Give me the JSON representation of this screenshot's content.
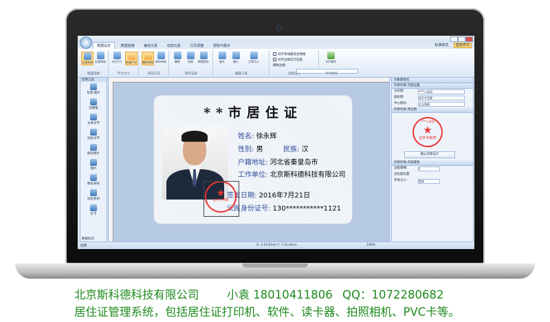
{
  "app": {
    "ribbon_tabs": [
      "数据设定",
      "数据连接",
      "静态元素",
      "动态元素",
      "打页调整",
      "帮助与展示"
    ],
    "style_links": [
      "标准样式",
      "蓝色样式"
    ],
    "ribbon_groups": [
      {
        "label": "版面选择",
        "buttons": [
          "正面布局",
          "反面布局"
        ]
      },
      {
        "label": "尺寸大小",
        "buttons": [
          "卡片尺寸",
          "标准尺寸"
        ]
      },
      {
        "label": "布局方向",
        "buttons": [
          "横向布局",
          "纵向布局"
        ]
      },
      {
        "label": "操作记录",
        "buttons": [
          "删除",
          "还原",
          "新版保存"
        ]
      },
      {
        "label": "编辑工具",
        "buttons": [
          "放大",
          "缩小",
          "正常大小"
        ]
      },
      {
        "label": "边框选择",
        "buttons": []
      },
      {
        "label": "卡片制作",
        "buttons": [
          "卡片制作"
        ]
      }
    ],
    "checkboxes": [
      "对齐布线最适合网格",
      "对齐边缘实行边框"
    ],
    "border_field_label": "模板边框:",
    "toolbox": {
      "title": "常用工具",
      "items": [
        "背景·图片",
        "创建框",
        "文本文字",
        "动态文字",
        "图形图片",
        "图片",
        "静态条码",
        "动态条码",
        "打卡"
      ],
      "footer": "数据标识"
    },
    "card": {
      "title": "**市居住证",
      "fields": [
        {
          "label": "姓名:",
          "value": "徐永辉"
        },
        {
          "label": "性别:",
          "value": "男"
        },
        {
          "label": "民族:",
          "value": "汉"
        },
        {
          "label": "户籍地址:",
          "value": "河北省秦皇岛市"
        },
        {
          "label": "工作单位:",
          "value": "北京斯科德科技有限公司"
        },
        {
          "label": "签发日期:",
          "value": "2016年7月21日"
        },
        {
          "label": "公民身份证号:",
          "value": "130***********1121"
        }
      ],
      "stamp_text": "证件专用章"
    },
    "props": {
      "title": "对象属性栏",
      "section1": "印章印章-内容设置",
      "rows": [
        {
          "label": "主标题:",
          "value": "****公安局"
        },
        {
          "label": "副标题:",
          "value": "证件专用章"
        },
        {
          "label": "中心图标:",
          "value": "五五角星"
        }
      ],
      "section2": "印章印章-预览图",
      "preview_top": "****公安局",
      "preview_bottom": "证件专用章",
      "confirm_button": "确认印章设计",
      "section3": "印章印章-内容属性",
      "rows2": [
        {
          "label": "边框粗细:",
          "value": "2"
        },
        {
          "label": "主标题设置",
          "value": ""
        },
        {
          "label": "字体大小:",
          "value": "黑体"
        }
      ]
    },
    "status": {
      "left": "就绪",
      "coords": "X: 3.23,0mm Y: 7.31,0mm",
      "zoom": "100%"
    }
  },
  "footer": {
    "company": "北京斯科德科技有限公司",
    "contact": "小袁 18010411806",
    "qq": "QQ：1072280682",
    "description": "居住证管理系统，包括居住证打印机、软件、读卡器、拍照相机、PVC卡等。"
  }
}
